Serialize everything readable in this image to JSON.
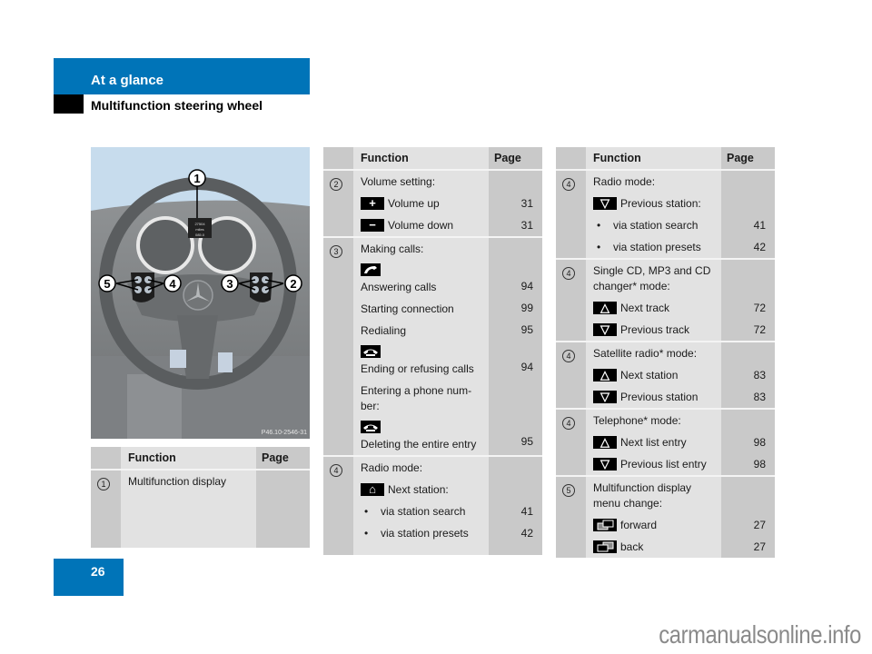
{
  "header": {
    "section": "At a glance",
    "subsection": "Multifunction steering wheel"
  },
  "figure": {
    "code": "P46.10-2546-31",
    "callouts": [
      "1",
      "2",
      "3",
      "4",
      "5"
    ],
    "display_text": [
      "27504",
      "miles",
      "085.0"
    ]
  },
  "table_headers": {
    "function": "Function",
    "page": "Page"
  },
  "table1": {
    "rows": [
      {
        "num": "1",
        "function": "Multifunction display",
        "page": ""
      }
    ]
  },
  "table2": {
    "groups": [
      {
        "num": "2",
        "title": "Volume setting:",
        "items": [
          {
            "icon": "plus-icon",
            "label": "Volume up",
            "page": "31"
          },
          {
            "icon": "minus-icon",
            "label": "Volume down",
            "page": "31"
          }
        ]
      },
      {
        "num": "3",
        "title": "Making calls:",
        "items": [
          {
            "icon": "phone-answer-icon",
            "label": "Answering calls",
            "page": "94"
          },
          {
            "label": "Starting connection",
            "page": "99"
          },
          {
            "label": "Redialing",
            "page": "95"
          },
          {
            "icon": "phone-hangup-icon",
            "label": "Ending or refusing calls",
            "page": "94"
          },
          {
            "label": "Entering a phone num-ber:",
            "page": ""
          },
          {
            "icon": "phone-hangup-icon",
            "label": "Deleting the entire entry",
            "page": "95"
          }
        ]
      },
      {
        "num": "4",
        "title": "Radio mode:",
        "items": [
          {
            "icon": "arrow-up-icon",
            "label": "Next station:",
            "page": ""
          },
          {
            "bullet": "•",
            "label": "via station search",
            "page": "41"
          },
          {
            "bullet": "•",
            "label": "via station presets",
            "page": "42"
          }
        ]
      }
    ]
  },
  "table3": {
    "groups": [
      {
        "num": "4",
        "title": "Radio mode:",
        "items": [
          {
            "icon": "arrow-down-icon",
            "label": "Previous station:",
            "page": ""
          },
          {
            "bullet": "•",
            "label": "via station search",
            "page": "41"
          },
          {
            "bullet": "•",
            "label": "via station presets",
            "page": "42"
          }
        ]
      },
      {
        "num": "4",
        "title": "Single CD, MP3 and CD changer* mode:",
        "items": [
          {
            "icon": "arrow-up-icon",
            "label": "Next track",
            "page": "72"
          },
          {
            "icon": "arrow-down-icon",
            "label": "Previous track",
            "page": "72"
          }
        ]
      },
      {
        "num": "4",
        "title": "Satellite radio* mode:",
        "items": [
          {
            "icon": "arrow-up-icon",
            "label": "Next station",
            "page": "83"
          },
          {
            "icon": "arrow-down-icon",
            "label": "Previous station",
            "page": "83"
          }
        ]
      },
      {
        "num": "4",
        "title": "Telephone* mode:",
        "items": [
          {
            "icon": "arrow-up-icon",
            "label": "Next list entry",
            "page": "98"
          },
          {
            "icon": "arrow-down-icon",
            "label": "Previous list entry",
            "page": "98"
          }
        ]
      },
      {
        "num": "5",
        "title": "Multifunction display menu change:",
        "items": [
          {
            "icon": "display-forward-icon",
            "label": "forward",
            "page": "27"
          },
          {
            "icon": "display-back-icon",
            "label": "back",
            "page": "27"
          }
        ]
      }
    ]
  },
  "footer": {
    "page_number": "26",
    "watermark": "carmanualsonline.info"
  },
  "colors": {
    "brand_blue": "#0074b8",
    "cell_dark": "#c9c9c9",
    "cell_light": "#e2e2e2"
  }
}
